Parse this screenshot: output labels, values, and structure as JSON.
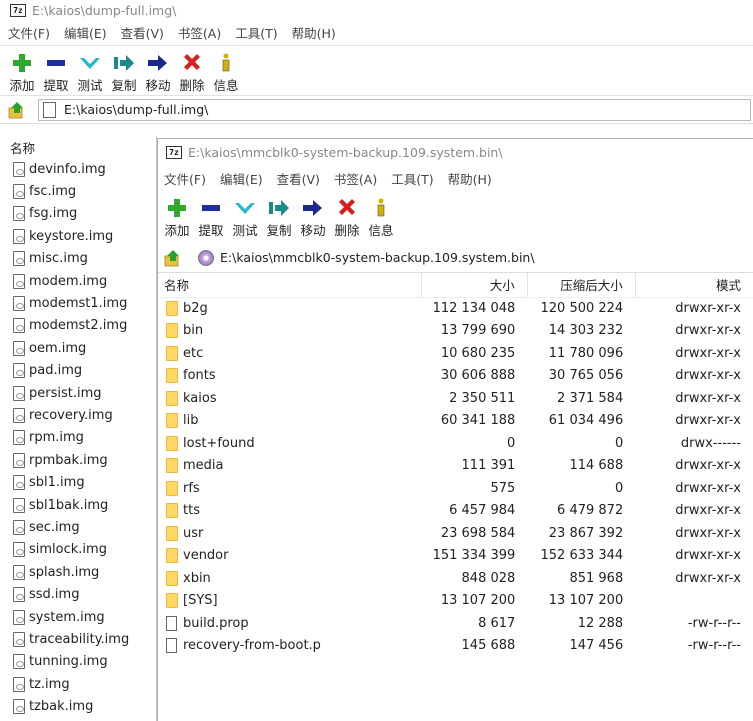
{
  "outer": {
    "title": "E:\\kaios\\dump-full.img\\",
    "app_icon_text": "7z",
    "menu": [
      "文件(F)",
      "编辑(E)",
      "查看(V)",
      "书签(A)",
      "工具(T)",
      "帮助(H)"
    ],
    "toolbar": [
      {
        "icon": "add-icon",
        "label": "添加"
      },
      {
        "icon": "extract-icon",
        "label": "提取"
      },
      {
        "icon": "test-icon",
        "label": "测试"
      },
      {
        "icon": "copy-icon",
        "label": "复制"
      },
      {
        "icon": "move-icon",
        "label": "移动"
      },
      {
        "icon": "delete-icon",
        "label": "删除"
      },
      {
        "icon": "info-icon",
        "label": "信息"
      }
    ],
    "address": "E:\\kaios\\dump-full.img\\",
    "list_header": "名称",
    "files": [
      "devinfo.img",
      "fsc.img",
      "fsg.img",
      "keystore.img",
      "misc.img",
      "modem.img",
      "modemst1.img",
      "modemst2.img",
      "oem.img",
      "pad.img",
      "persist.img",
      "recovery.img",
      "rpm.img",
      "rpmbak.img",
      "sbl1.img",
      "sbl1bak.img",
      "sec.img",
      "simlock.img",
      "splash.img",
      "ssd.img",
      "system.img",
      "traceability.img",
      "tunning.img",
      "tz.img",
      "tzbak.img"
    ]
  },
  "inner": {
    "title": "E:\\kaios\\mmcblk0-system-backup.109.system.bin\\",
    "app_icon_text": "7z",
    "menu": [
      "文件(F)",
      "编辑(E)",
      "查看(V)",
      "书签(A)",
      "工具(T)",
      "帮助(H)"
    ],
    "toolbar": [
      {
        "icon": "add-icon",
        "label": "添加"
      },
      {
        "icon": "extract-icon",
        "label": "提取"
      },
      {
        "icon": "test-icon",
        "label": "测试"
      },
      {
        "icon": "copy-icon",
        "label": "复制"
      },
      {
        "icon": "move-icon",
        "label": "移动"
      },
      {
        "icon": "delete-icon",
        "label": "删除"
      },
      {
        "icon": "info-icon",
        "label": "信息"
      }
    ],
    "address": "E:\\kaios\\mmcblk0-system-backup.109.system.bin\\",
    "columns": {
      "name": "名称",
      "size": "大小",
      "packed": "压缩后大小",
      "mode": "模式"
    },
    "rows": [
      {
        "type": "folder",
        "name": "b2g",
        "size": "112 134 048",
        "packed": "120 500 224",
        "mode": "drwxr-xr-x"
      },
      {
        "type": "folder",
        "name": "bin",
        "size": "13 799 690",
        "packed": "14 303 232",
        "mode": "drwxr-xr-x"
      },
      {
        "type": "folder",
        "name": "etc",
        "size": "10 680 235",
        "packed": "11 780 096",
        "mode": "drwxr-xr-x"
      },
      {
        "type": "folder",
        "name": "fonts",
        "size": "30 606 888",
        "packed": "30 765 056",
        "mode": "drwxr-xr-x"
      },
      {
        "type": "folder",
        "name": "kaios",
        "size": "2 350 511",
        "packed": "2 371 584",
        "mode": "drwxr-xr-x"
      },
      {
        "type": "folder",
        "name": "lib",
        "size": "60 341 188",
        "packed": "61 034 496",
        "mode": "drwxr-xr-x"
      },
      {
        "type": "folder",
        "name": "lost+found",
        "size": "0",
        "packed": "0",
        "mode": "drwx------"
      },
      {
        "type": "folder",
        "name": "media",
        "size": "111 391",
        "packed": "114 688",
        "mode": "drwxr-xr-x"
      },
      {
        "type": "folder",
        "name": "rfs",
        "size": "575",
        "packed": "0",
        "mode": "drwxr-xr-x"
      },
      {
        "type": "folder",
        "name": "tts",
        "size": "6 457 984",
        "packed": "6 479 872",
        "mode": "drwxr-xr-x"
      },
      {
        "type": "folder",
        "name": "usr",
        "size": "23 698 584",
        "packed": "23 867 392",
        "mode": "drwxr-xr-x"
      },
      {
        "type": "folder",
        "name": "vendor",
        "size": "151 334 399",
        "packed": "152 633 344",
        "mode": "drwxr-xr-x"
      },
      {
        "type": "folder",
        "name": "xbin",
        "size": "848 028",
        "packed": "851 968",
        "mode": "drwxr-xr-x"
      },
      {
        "type": "folder",
        "name": "[SYS]",
        "size": "13 107 200",
        "packed": "13 107 200",
        "mode": ""
      },
      {
        "type": "file",
        "name": "build.prop",
        "size": "8 617",
        "packed": "12 288",
        "mode": "-rw-r--r--"
      },
      {
        "type": "file",
        "name": "recovery-from-boot.p",
        "size": "145 688",
        "packed": "147 456",
        "mode": "-rw-r--r--"
      }
    ]
  },
  "colors": {
    "add": "#2fa82f",
    "extract": "#1f2fa0",
    "test": "#26b8c8",
    "copy": "#1a8a8a",
    "move": "#1a2a8a",
    "delete": "#d42020",
    "info": "#d4b000",
    "folder": "#ffd866"
  }
}
